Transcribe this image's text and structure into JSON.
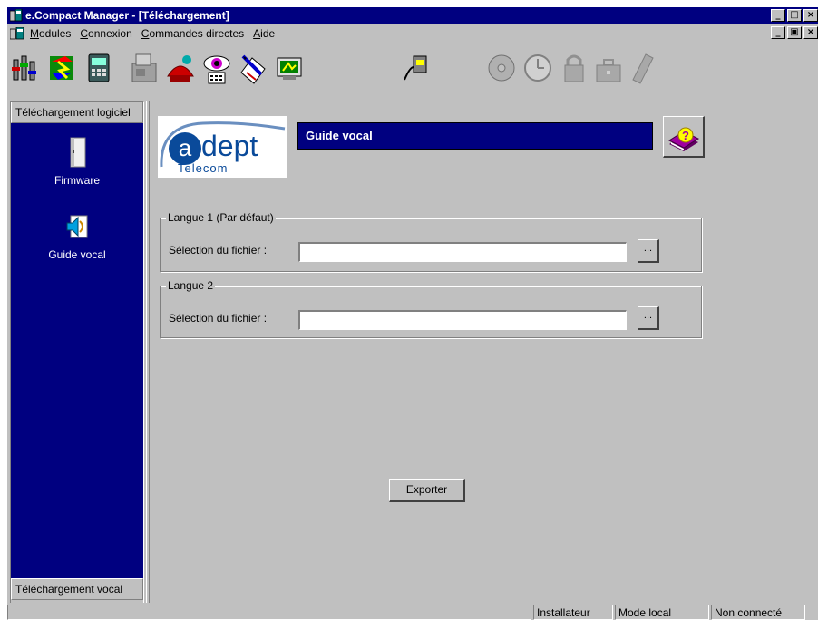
{
  "window": {
    "title": "e.Compact Manager - [Téléchargement]",
    "minimize": "_",
    "maximize": "□",
    "close": "×",
    "restore": "ₐ"
  },
  "menu": {
    "items": [
      {
        "label_ul": "M",
        "label_rest": "odules"
      },
      {
        "label_ul": "C",
        "label_rest": "onnexion"
      },
      {
        "label_ul": "C",
        "label_rest": "ommandes directes"
      },
      {
        "label_ul": "A",
        "label_rest": "ide"
      }
    ]
  },
  "toolbar": {
    "icons": [
      "equalizer-icon",
      "exchange-icon",
      "phone-device-icon",
      "fax-icon",
      "phone-handset-icon",
      "eye-monitor-icon",
      "pen-document-icon",
      "tv-network-icon",
      "connect-plug-icon",
      "cd-icon",
      "clock-icon",
      "lock-icon",
      "briefcase-icon",
      "mobile-phone-icon"
    ]
  },
  "sidebar": {
    "top_group": "Téléchargement logiciel",
    "bottom_group": "Téléchargement vocal",
    "items": [
      {
        "label": "Firmware",
        "icon": "firmware-icon"
      },
      {
        "label": "Guide vocal",
        "icon": "guide-vocal-icon"
      }
    ]
  },
  "logo": {
    "letter": "a",
    "word": "dept",
    "sub": "Telecom"
  },
  "section": {
    "title": "Guide vocal",
    "help_icon": "help-book-icon"
  },
  "form": {
    "lang1": {
      "legend": "Langue 1 (Par défaut)",
      "label": "Sélection du fichier :",
      "value": "",
      "browse": "..."
    },
    "lang2": {
      "legend": "Langue 2",
      "label": "Sélection du fichier :",
      "value": "",
      "browse": "..."
    },
    "export": "Exporter"
  },
  "status": {
    "role": "Installateur",
    "mode": "Mode local",
    "connection": "Non connecté"
  },
  "colors": {
    "navy": "#000080",
    "face": "#c0c0c0"
  }
}
